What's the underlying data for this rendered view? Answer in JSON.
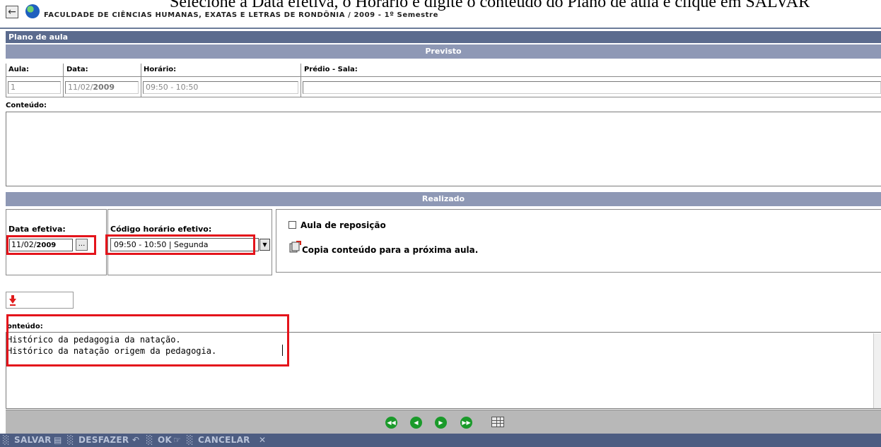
{
  "caption": "Selecione a Data efetiva, o Horário e digite o conteúdo do Plano de aula e clique em SALVAR",
  "header": {
    "back_icon": "back-arrow-icon",
    "globe_icon": "globe-icon",
    "institution": "FACULDADE DE CIÊNCIAS HUMANAS, EXATAS E LETRAS DE RONDÔNIA / 2009 - 1º Semestre"
  },
  "plano": {
    "title": "Plano de aula"
  },
  "previsto": {
    "title": "Previsto",
    "labels": {
      "aula": "Aula:",
      "data": "Data:",
      "horario": "Horário:",
      "predio": "Prédio - Sala:",
      "conteudo": "Conteúdo:"
    },
    "values": {
      "aula": "1",
      "data_day": "11/02/",
      "data_year": "2009",
      "horario": "09:50 - 10:50",
      "predio": ""
    }
  },
  "realizado": {
    "title": "Realizado",
    "data_efetiva_label": "Data efetiva:",
    "data_efetiva_day": "11/02/",
    "data_efetiva_year": "2009",
    "calendar_button": "...",
    "codigo_label": "Código horário efetivo:",
    "codigo_value": "09:50 - 10:50 | Segunda",
    "aula_reposicao": "Aula de reposição",
    "copia_conteudo": "Copia conteúdo para a próxima aula."
  },
  "conteudo_real": {
    "label": "onteúdo:",
    "lines": [
      "Histórico da pedagogia da natação.",
      "Histórico da natação origem da pedagogia."
    ]
  },
  "nav": {
    "first": "first-record-icon",
    "prev": "prev-record-icon",
    "next": "next-record-icon",
    "last": "last-record-icon",
    "table": "table-view-icon"
  },
  "actions": {
    "salvar": "SALVAR",
    "desfazer": "DESFAZER",
    "ok": "OK",
    "cancelar": "CANCELAR"
  },
  "colors": {
    "bar_dark": "#5b6b8e",
    "bar_light": "#8e98b5",
    "highlight": "#e4141b",
    "nav_green": "#1a9a2a"
  }
}
